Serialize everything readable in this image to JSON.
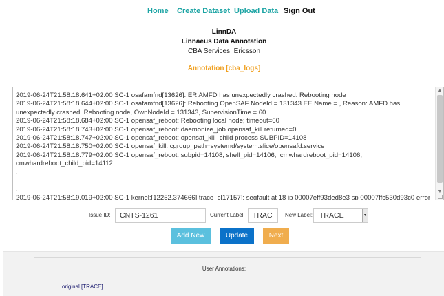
{
  "nav": {
    "home": "Home",
    "create_dataset": "Create Dataset",
    "upload_data": "Upload Data",
    "sign_out": "Sign Out"
  },
  "header": {
    "title": "LinnDA",
    "subtitle": "Linnaeus Data Annotation",
    "org": "CBA Services, Ericsson",
    "annotation_title": "Annotation [cba_logs]"
  },
  "log": {
    "text": "2019-06-24T21:58:18.641+02:00 SC-1 osafamfnd[13626]: ER AMFD has unexpectedly crashed. Rebooting node\n2019-06-24T21:58:18.644+02:00 SC-1 osafamfnd[13626]: Rebooting OpenSAF NodeId = 131343 EE Name = , Reason: AMFD has unexpectedly crashed. Rebooting node, OwnNodeId = 131343, SupervisionTime = 60\n2019-06-24T21:58:18.684+02:00 SC-1 opensaf_reboot: Rebooting local node; timeout=60\n2019-06-24T21:58:18.743+02:00 SC-1 opensaf_reboot: daemonize_job opensaf_kill returned=0\n2019-06-24T21:58:18.747+02:00 SC-1 opensaf_reboot: opensaf_kill  child process SUBPID=14108\n2019-06-24T21:58:18.750+02:00 SC-1 opensaf_kill: cgroup_path=systemd/system.slice/opensafd.service\n2019-06-24T21:58:18.779+02:00 SC-1 opensaf_reboot: subpid=14108, shell_pid=14106,  cmwhardreboot_pid=14106, cmwhardreboot_child_pid=14112\n.\n.\n.\n2019-06-24T21:58:19.019+02:00 SC-1 kernel:[12252.374666] trace_c[17157]: segfault at 18 ip 00007eff93ded8e3 sp 00007ffc530d93c0 error"
  },
  "form": {
    "issue_label": "Issue ID:",
    "issue_value": "CNTS-1261",
    "current_label": "Current Label:",
    "current_value": "TRACE",
    "new_label": "New Label:",
    "new_value": "TRACE"
  },
  "buttons": {
    "add_new": "Add New",
    "update": "Update",
    "next": "Next"
  },
  "annotations": {
    "heading": "User Annotations:",
    "items": [
      "original [TRACE]"
    ]
  },
  "colors": {
    "nav_link": "#1aa3a3",
    "annotation_title": "#f0a020",
    "add_button": "#5bc0de",
    "update_button": "#0b72c9",
    "next_button": "#f0ad4e"
  }
}
